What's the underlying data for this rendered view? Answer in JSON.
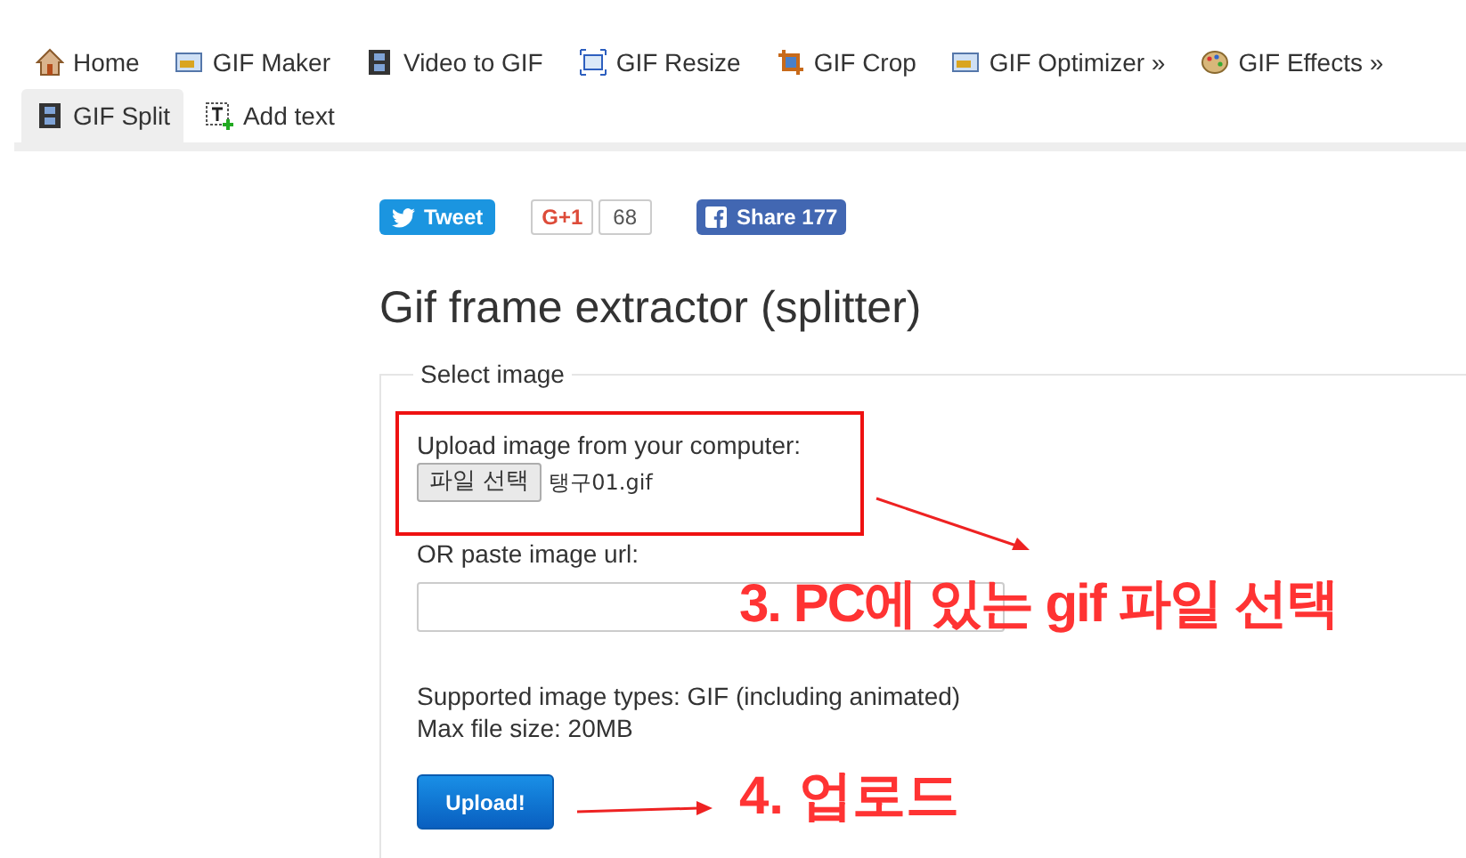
{
  "nav": [
    {
      "label": "Home",
      "kind": "house",
      "selected": false
    },
    {
      "label": "GIF Maker",
      "kind": "photo",
      "selected": false
    },
    {
      "label": "Video to GIF",
      "kind": "film",
      "selected": false
    },
    {
      "label": "GIF Resize",
      "kind": "resize",
      "selected": false
    },
    {
      "label": "GIF Crop",
      "kind": "crop",
      "selected": false
    },
    {
      "label": "GIF Optimizer »",
      "kind": "photo",
      "selected": false
    },
    {
      "label": "GIF Effects »",
      "kind": "palette",
      "selected": false
    },
    {
      "label": "GIF Split",
      "kind": "film",
      "selected": true
    },
    {
      "label": "Add text",
      "kind": "text",
      "selected": false
    }
  ],
  "social": {
    "tweet": "Tweet",
    "gplus": "G+1",
    "gplus_count": "68",
    "share": "Share 177"
  },
  "heading": "Gif frame extractor (splitter)",
  "form": {
    "legend": "Select image",
    "upload_label": "Upload image from your computer:",
    "file_button": "파일 선택",
    "file_name": "탱구01.gif",
    "url_label": "OR paste image url:",
    "types": "Supported image types: GIF (including animated)",
    "max_size": "Max file size: 20MB",
    "submit": "Upload!"
  },
  "annotations": [
    "3. PC에 있는 gif 파일 선택",
    "4. 업로드"
  ]
}
